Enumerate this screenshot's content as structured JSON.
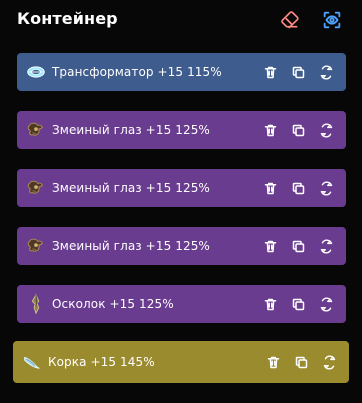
{
  "panel": {
    "title": "Контейнер",
    "icons": {
      "eraser": "eraser-icon",
      "visibility": "eye-icon"
    },
    "colors": {
      "eraser": "#ff8a84",
      "eye": "#4ea3ff"
    }
  },
  "items": [
    {
      "label": "Трансформатор +15  115%",
      "icon": "transformer-icon",
      "color": "#3f5c8e"
    },
    {
      "label": "Змеиный глаз +15  125%",
      "icon": "snake-eye-icon",
      "color": "#6a3c8f"
    },
    {
      "label": "Змеиный глаз +15  125%",
      "icon": "snake-eye-icon",
      "color": "#6a3c8f"
    },
    {
      "label": "Змеиный глаз +15  125%",
      "icon": "snake-eye-icon",
      "color": "#6a3c8f"
    },
    {
      "label": "Осколок +15  125%",
      "icon": "shard-icon",
      "color": "#6a3c8f"
    },
    {
      "label": "Корка +15  145%",
      "icon": "crust-icon",
      "color": "#9b8b2f"
    }
  ],
  "actions": {
    "delete": "trash-icon",
    "copy": "copy-icon",
    "refresh": "refresh-icon"
  }
}
